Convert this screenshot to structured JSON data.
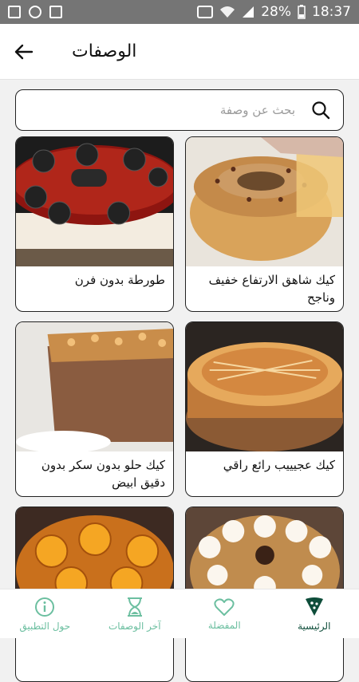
{
  "status_bar": {
    "battery": "28%",
    "time": "18:37"
  },
  "header": {
    "title": "الوصفات"
  },
  "search": {
    "placeholder": "بحث عن وصفة"
  },
  "recipes": [
    {
      "title": "كيك شاهق الارتفاع خفيف وناجح"
    },
    {
      "title": "طورطة بدون فرن"
    },
    {
      "title": "كيك عجيييب رائع راقي"
    },
    {
      "title": "كيك حلو بدون سكر بدون دقيق ابيض"
    },
    {
      "title": ""
    },
    {
      "title": ""
    }
  ],
  "bottom_nav": [
    {
      "label": "حول التطبيق",
      "icon": "info-icon"
    },
    {
      "label": "آخر الوصفات",
      "icon": "hourglass-icon"
    },
    {
      "label": "المفضلة",
      "icon": "heart-icon"
    },
    {
      "label": "الرئيسية",
      "icon": "pizza-slice-icon",
      "active": true
    }
  ],
  "colors": {
    "accent": "#0e4d3a",
    "nav_inactive": "#6cbfa0",
    "status_bar": "#757575"
  }
}
